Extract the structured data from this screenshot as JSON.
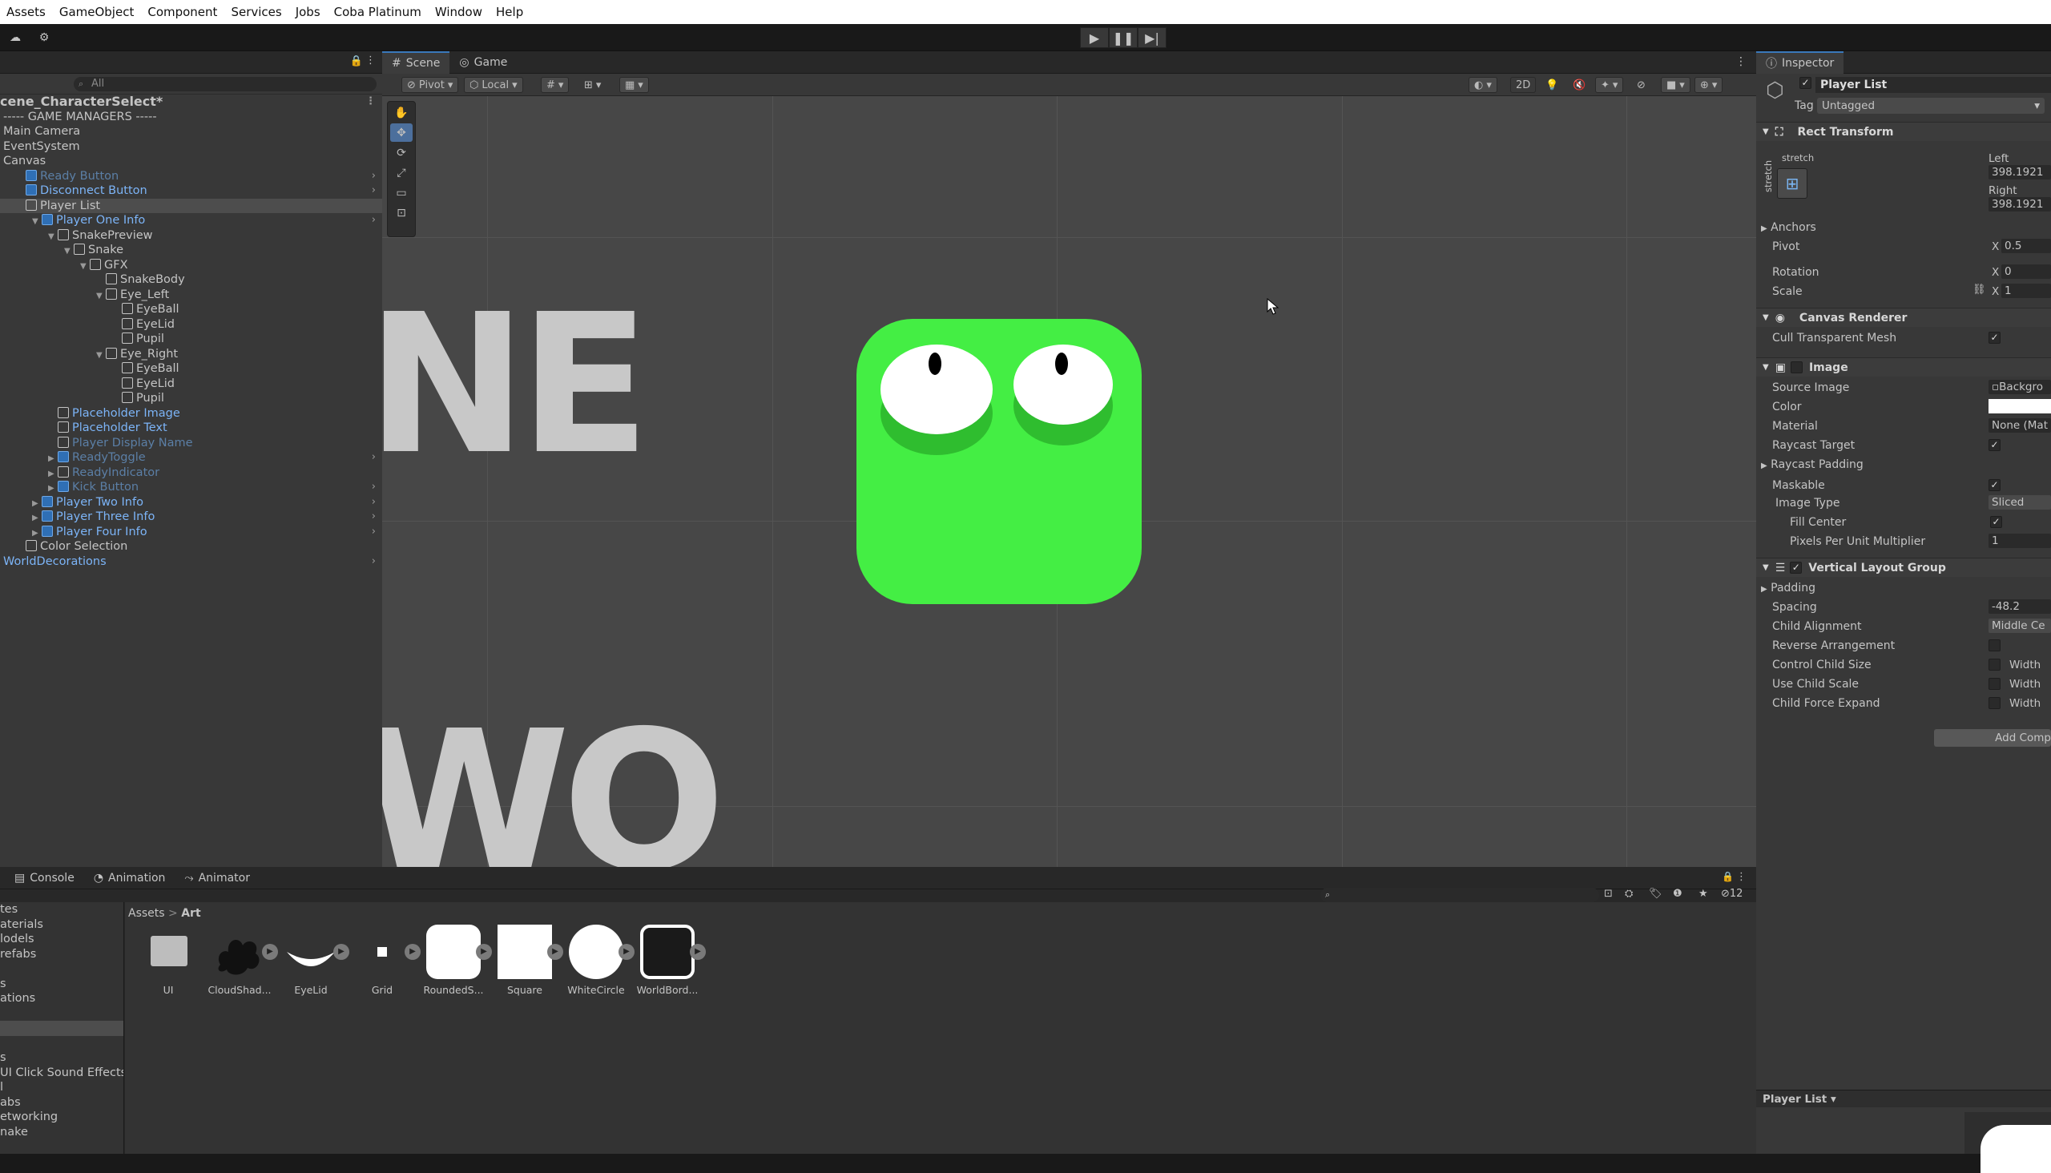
{
  "menu": [
    "Assets",
    "GameObject",
    "Component",
    "Services",
    "Jobs",
    "Coba Platinum",
    "Window",
    "Help"
  ],
  "hierarchy": {
    "search_placeholder": "All",
    "scene_name": "cene_CharacterSelect*",
    "rows": [
      {
        "label": "----- GAME MANAGERS -----",
        "indent": 0,
        "style": "normal"
      },
      {
        "label": "Main Camera",
        "indent": 0,
        "style": "normal"
      },
      {
        "label": "EventSystem",
        "indent": 0,
        "style": "normal"
      },
      {
        "label": "Canvas",
        "indent": 0,
        "style": "normal"
      },
      {
        "label": "Ready Button",
        "indent": 1,
        "style": "dim",
        "icon": "blue",
        "chev": true
      },
      {
        "label": "Disconnect Button",
        "indent": 1,
        "style": "blue",
        "icon": "blue",
        "chev": true
      },
      {
        "label": "Player List",
        "indent": 1,
        "style": "normal",
        "icon": "cube",
        "sel": true
      },
      {
        "label": "Player One Info",
        "indent": 2,
        "style": "blue",
        "icon": "blue",
        "arrow": "down",
        "chev": true
      },
      {
        "label": "SnakePreview",
        "indent": 3,
        "style": "normal",
        "icon": "cube",
        "arrow": "down"
      },
      {
        "label": "Snake",
        "indent": 4,
        "style": "normal",
        "icon": "cube",
        "arrow": "down"
      },
      {
        "label": "GFX",
        "indent": 5,
        "style": "normal",
        "icon": "cube",
        "arrow": "down"
      },
      {
        "label": "SnakeBody",
        "indent": 6,
        "style": "normal",
        "icon": "cube"
      },
      {
        "label": "Eye_Left",
        "indent": 6,
        "style": "normal",
        "icon": "cube",
        "arrow": "down"
      },
      {
        "label": "EyeBall",
        "indent": 7,
        "style": "normal",
        "icon": "cube"
      },
      {
        "label": "EyeLid",
        "indent": 7,
        "style": "normal",
        "icon": "cube"
      },
      {
        "label": "Pupil",
        "indent": 7,
        "style": "normal",
        "icon": "cube"
      },
      {
        "label": "Eye_Right",
        "indent": 6,
        "style": "normal",
        "icon": "cube",
        "arrow": "down"
      },
      {
        "label": "EyeBall",
        "indent": 7,
        "style": "normal",
        "icon": "cube"
      },
      {
        "label": "EyeLid",
        "indent": 7,
        "style": "normal",
        "icon": "cube"
      },
      {
        "label": "Pupil",
        "indent": 7,
        "style": "normal",
        "icon": "cube"
      },
      {
        "label": "Placeholder Image",
        "indent": 3,
        "style": "blue",
        "icon": "cube"
      },
      {
        "label": "Placeholder Text",
        "indent": 3,
        "style": "blue",
        "icon": "cube"
      },
      {
        "label": "Player Display Name",
        "indent": 3,
        "style": "dim",
        "icon": "cube"
      },
      {
        "label": "ReadyToggle",
        "indent": 3,
        "style": "dim",
        "icon": "blue",
        "arrow": "right",
        "chev": true
      },
      {
        "label": "ReadyIndicator",
        "indent": 3,
        "style": "dim",
        "icon": "cube",
        "arrow": "right"
      },
      {
        "label": "Kick Button",
        "indent": 3,
        "style": "dim",
        "icon": "blue",
        "arrow": "right",
        "chev": true
      },
      {
        "label": "Player Two Info",
        "indent": 2,
        "style": "blue",
        "icon": "blue",
        "arrow": "right",
        "chev": true
      },
      {
        "label": "Player Three Info",
        "indent": 2,
        "style": "blue",
        "icon": "blue",
        "arrow": "right",
        "chev": true
      },
      {
        "label": "Player Four Info",
        "indent": 2,
        "style": "blue",
        "icon": "blue",
        "arrow": "right",
        "chev": true
      },
      {
        "label": "Color Selection",
        "indent": 1,
        "style": "normal",
        "icon": "cube"
      },
      {
        "label": "WorldDecorations",
        "indent": 0,
        "style": "blue",
        "chev": true
      }
    ]
  },
  "scene": {
    "tabs": [
      "Scene",
      "Game"
    ],
    "pivot": "Pivot",
    "local": "Local",
    "mode_2d": "2D",
    "big_text_1": "NE",
    "big_text_2": "WO"
  },
  "inspector": {
    "tab": "Inspector",
    "object_name": "Player List",
    "tag_label": "Tag",
    "tag_value": "Untagged",
    "rect_transform": "Rect Transform",
    "stretch_label": "stretch",
    "left_label": "Left",
    "left_value": "398.1921",
    "right_label": "Right",
    "right_value": "398.1921",
    "anchors": "Anchors",
    "pivot": "Pivot",
    "pivot_x_label": "X",
    "pivot_x": "0.5",
    "rotation": "Rotation",
    "rot_x_label": "X",
    "rot_x": "0",
    "scale": "Scale",
    "scale_x_label": "X",
    "scale_x": "1",
    "canvas_renderer": "Canvas Renderer",
    "cull": "Cull Transparent Mesh",
    "image": "Image",
    "source_image": "Source Image",
    "source_image_val": "Backgro",
    "color": "Color",
    "material": "Material",
    "material_val": "None (Mat",
    "raycast_target": "Raycast Target",
    "raycast_padding": "Raycast Padding",
    "maskable": "Maskable",
    "image_type": "Image Type",
    "image_type_val": "Sliced",
    "fill_center": "Fill Center",
    "ppu": "Pixels Per Unit Multiplier",
    "ppu_val": "1",
    "vlg": "Vertical Layout Group",
    "padding": "Padding",
    "spacing": "Spacing",
    "spacing_val": "-48.2",
    "child_alignment": "Child Alignment",
    "child_alignment_val": "Middle Ce",
    "reverse": "Reverse Arrangement",
    "control_size": "Control Child Size",
    "use_scale": "Use Child Scale",
    "force_expand": "Child Force Expand",
    "width": "Width",
    "add_component": "Add Comp",
    "preview_label": "Player List"
  },
  "bottom": {
    "tabs": [
      "Console",
      "Animation",
      "Animator"
    ],
    "breadcrumb_root": "Assets",
    "breadcrumb_sep": ">",
    "breadcrumb_leaf": "Art",
    "hidden_count": "12",
    "left_items": [
      "tes",
      "aterials",
      "lodels",
      "refabs",
      "",
      "s",
      "ations",
      "",
      "",
      "",
      "s",
      "UI Click Sound Effects I",
      "l",
      "abs",
      "etworking",
      "nake"
    ],
    "assets": [
      "UI",
      "CloudShad...",
      "EyeLid",
      "Grid",
      "RoundedS...",
      "Square",
      "WhiteCircle",
      "WorldBord..."
    ]
  }
}
